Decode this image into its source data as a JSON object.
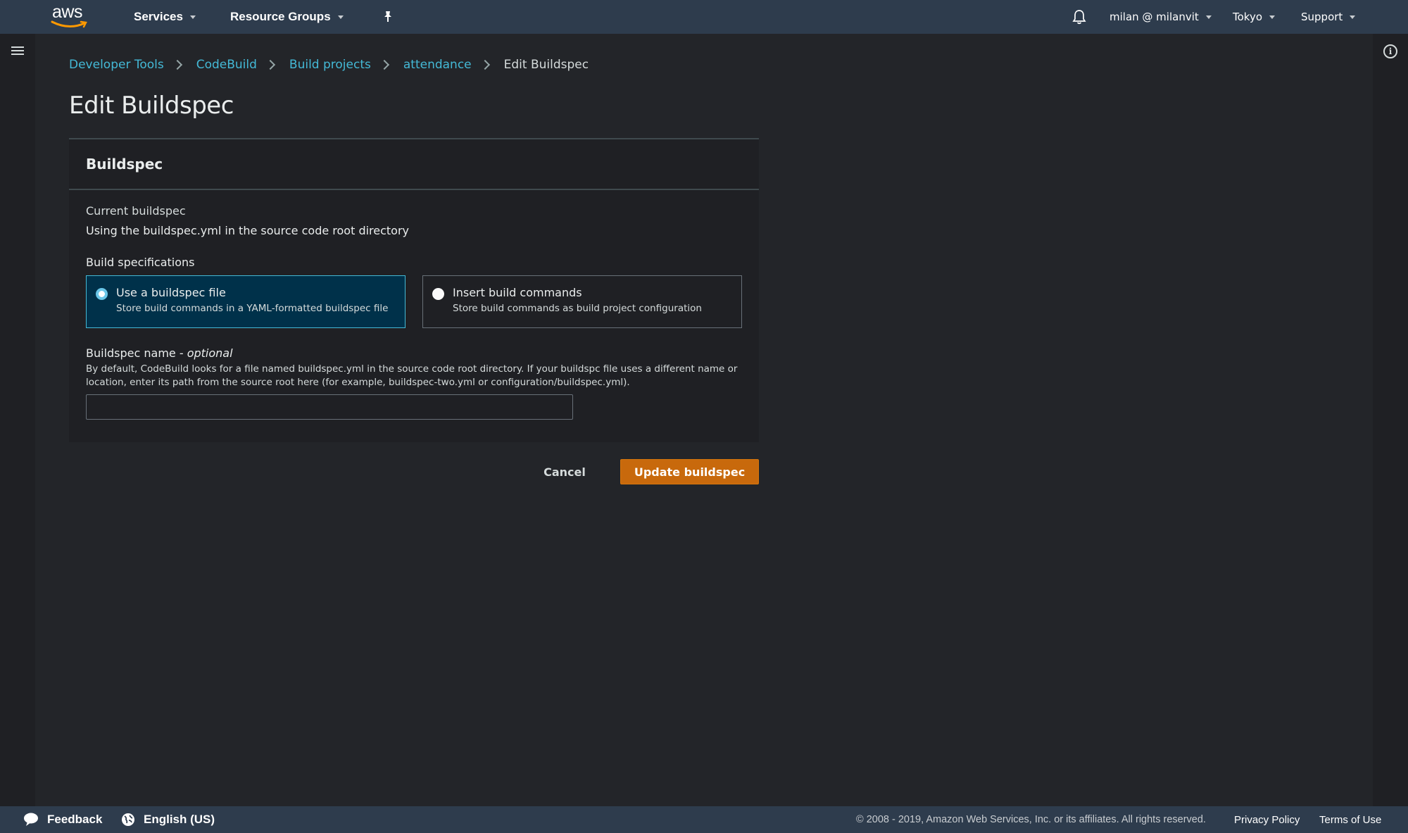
{
  "topnav": {
    "logo_text": "aws",
    "services_label": "Services",
    "resource_groups_label": "Resource Groups",
    "pin_icon": "pushpin-icon",
    "bell_icon": "bell-icon",
    "account_label": "milan @ milanvit",
    "region_label": "Tokyo",
    "support_label": "Support"
  },
  "sidebar": {
    "menu_icon": "hamburger-menu-icon"
  },
  "help_panel": {
    "info_icon": "info-icon",
    "info_glyph": "i"
  },
  "breadcrumb": {
    "items": [
      {
        "label": "Developer Tools",
        "link": true
      },
      {
        "label": "CodeBuild",
        "link": true
      },
      {
        "label": "Build projects",
        "link": true
      },
      {
        "label": "attendance",
        "link": true
      },
      {
        "label": "Edit Buildspec",
        "link": false
      }
    ]
  },
  "page": {
    "title": "Edit Buildspec"
  },
  "buildspec_panel": {
    "heading": "Buildspec",
    "current_label": "Current buildspec",
    "current_value": "Using the buildspec.yml in the source code root directory",
    "build_spec_label": "Build specifications",
    "options": [
      {
        "title": "Use a buildspec file",
        "description": "Store build commands in a YAML-formatted buildspec file",
        "selected": true
      },
      {
        "title": "Insert build commands",
        "description": "Store build commands as build project configuration",
        "selected": false
      }
    ],
    "name_field": {
      "label": "Buildspec name - ",
      "label_optional": "optional",
      "description": "By default, CodeBuild looks for a file named buildspec.yml in the source code root directory. If your buildspc file uses a different name or location, enter its path from the source root here (for example, buildspec-two.yml or configuration/buildspec.yml).",
      "value": "",
      "placeholder": ""
    }
  },
  "actions": {
    "cancel_label": "Cancel",
    "submit_label": "Update buildspec",
    "submit_color": "#c8690c"
  },
  "footer": {
    "feedback_label": "Feedback",
    "language_label": "English (US)",
    "copyright": "© 2008 - 2019, Amazon Web Services, Inc. or its affiliates. All rights reserved.",
    "privacy_label": "Privacy Policy",
    "terms_label": "Terms of Use"
  },
  "colors": {
    "link": "#44b9d6",
    "nav_bg": "#2e3c4d",
    "page_bg": "#232529",
    "selected_tile_bg": "#00314a",
    "selected_tile_border": "#44b9d6"
  }
}
